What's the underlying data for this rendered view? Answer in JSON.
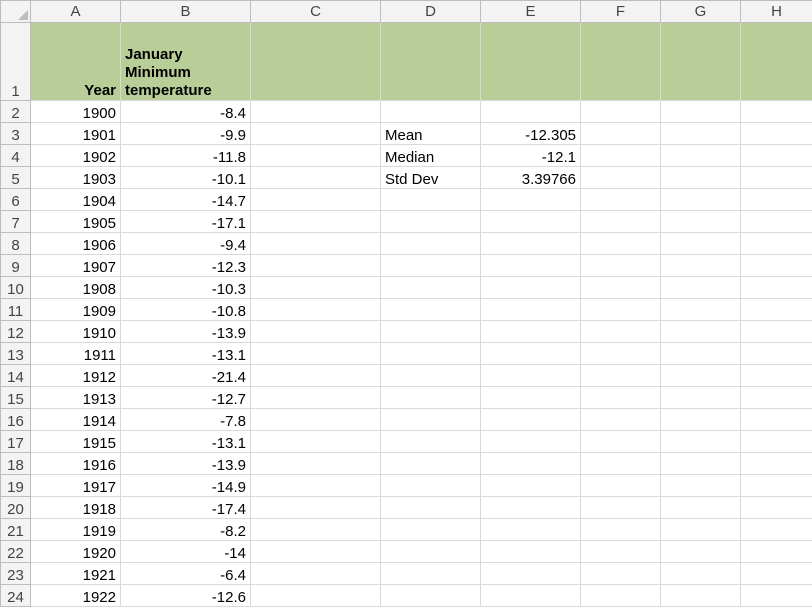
{
  "columns": [
    "A",
    "B",
    "C",
    "D",
    "E",
    "F",
    "G",
    "H"
  ],
  "header_row": {
    "A": "Year",
    "B": "January Minimum temperature"
  },
  "data_rows": [
    {
      "year": "1900",
      "temp": "-8.4"
    },
    {
      "year": "1901",
      "temp": "-9.9"
    },
    {
      "year": "1902",
      "temp": "-11.8"
    },
    {
      "year": "1903",
      "temp": "-10.1"
    },
    {
      "year": "1904",
      "temp": "-14.7"
    },
    {
      "year": "1905",
      "temp": "-17.1"
    },
    {
      "year": "1906",
      "temp": "-9.4"
    },
    {
      "year": "1907",
      "temp": "-12.3"
    },
    {
      "year": "1908",
      "temp": "-10.3"
    },
    {
      "year": "1909",
      "temp": "-10.8"
    },
    {
      "year": "1910",
      "temp": "-13.9"
    },
    {
      "year": "1911",
      "temp": "-13.1"
    },
    {
      "year": "1912",
      "temp": "-21.4"
    },
    {
      "year": "1913",
      "temp": "-12.7"
    },
    {
      "year": "1914",
      "temp": "-7.8"
    },
    {
      "year": "1915",
      "temp": "-13.1"
    },
    {
      "year": "1916",
      "temp": "-13.9"
    },
    {
      "year": "1917",
      "temp": "-14.9"
    },
    {
      "year": "1918",
      "temp": "-17.4"
    },
    {
      "year": "1919",
      "temp": "-8.2"
    },
    {
      "year": "1920",
      "temp": "-14"
    },
    {
      "year": "1921",
      "temp": "-6.4"
    },
    {
      "year": "1922",
      "temp": "-12.6"
    }
  ],
  "stats": [
    {
      "label": "Mean",
      "value": "-12.305"
    },
    {
      "label": "Median",
      "value": "-12.1"
    },
    {
      "label": "Std Dev",
      "value": "3.39766"
    }
  ]
}
